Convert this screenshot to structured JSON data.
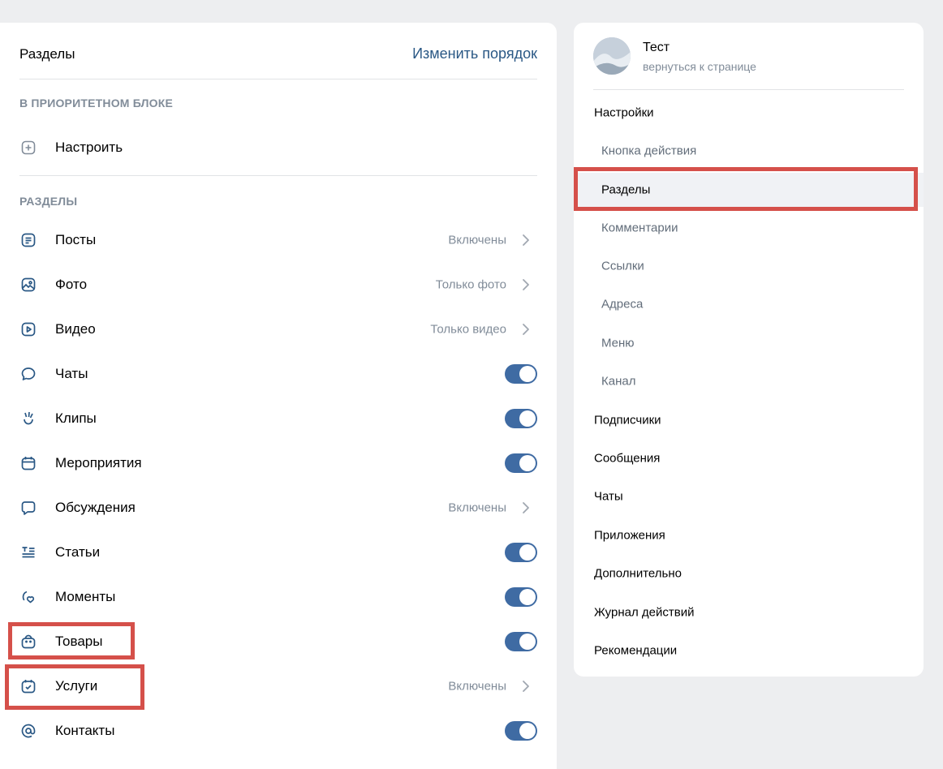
{
  "sections_panel": {
    "title": "Разделы",
    "reorder_link": "Изменить порядок",
    "priority_header": "В ПРИОРИТЕТНОМ БЛОКЕ",
    "configure_label": "Настроить",
    "sections_header": "РАЗДЕЛЫ",
    "items": [
      {
        "label": "Посты",
        "icon": "article-icon",
        "status": "Включены"
      },
      {
        "label": "Фото",
        "icon": "photo-icon",
        "status": "Только фото"
      },
      {
        "label": "Видео",
        "icon": "video-icon",
        "status": "Только видео"
      },
      {
        "label": "Чаты",
        "icon": "chat-icon",
        "toggle": true
      },
      {
        "label": "Клипы",
        "icon": "clips-icon",
        "toggle": true
      },
      {
        "label": "Мероприятия",
        "icon": "calendar-icon",
        "toggle": true
      },
      {
        "label": "Обсуждения",
        "icon": "discussion-icon",
        "status": "Включены"
      },
      {
        "label": "Статьи",
        "icon": "articles-icon",
        "toggle": true
      },
      {
        "label": "Моменты",
        "icon": "moments-icon",
        "toggle": true
      },
      {
        "label": "Товары",
        "icon": "shopping-bag-icon",
        "toggle": true
      },
      {
        "label": "Услуги",
        "icon": "services-icon",
        "status": "Включены"
      },
      {
        "label": "Контакты",
        "icon": "at-icon",
        "toggle": true
      }
    ]
  },
  "profile": {
    "name": "Тест",
    "back_link": "вернуться к странице"
  },
  "settings_nav": {
    "items": [
      {
        "label": "Настройки",
        "level": "main"
      },
      {
        "label": "Кнопка действия",
        "level": "sub"
      },
      {
        "label": "Разделы",
        "level": "sub",
        "active": true
      },
      {
        "label": "Комментарии",
        "level": "sub"
      },
      {
        "label": "Ссылки",
        "level": "sub"
      },
      {
        "label": "Адреса",
        "level": "sub"
      },
      {
        "label": "Меню",
        "level": "sub"
      },
      {
        "label": "Канал",
        "level": "sub"
      },
      {
        "label": "Подписчики",
        "level": "main"
      },
      {
        "label": "Сообщения",
        "level": "main"
      },
      {
        "label": "Чаты",
        "level": "main"
      },
      {
        "label": "Приложения",
        "level": "main"
      },
      {
        "label": "Дополнительно",
        "level": "main"
      },
      {
        "label": "Журнал действий",
        "level": "main"
      },
      {
        "label": "Рекомендации",
        "level": "main"
      }
    ]
  },
  "colors": {
    "accent": "#2a5885",
    "toggle_on": "#3f6ba3",
    "highlight_box": "#d5504a",
    "muted_text": "#818c99"
  }
}
